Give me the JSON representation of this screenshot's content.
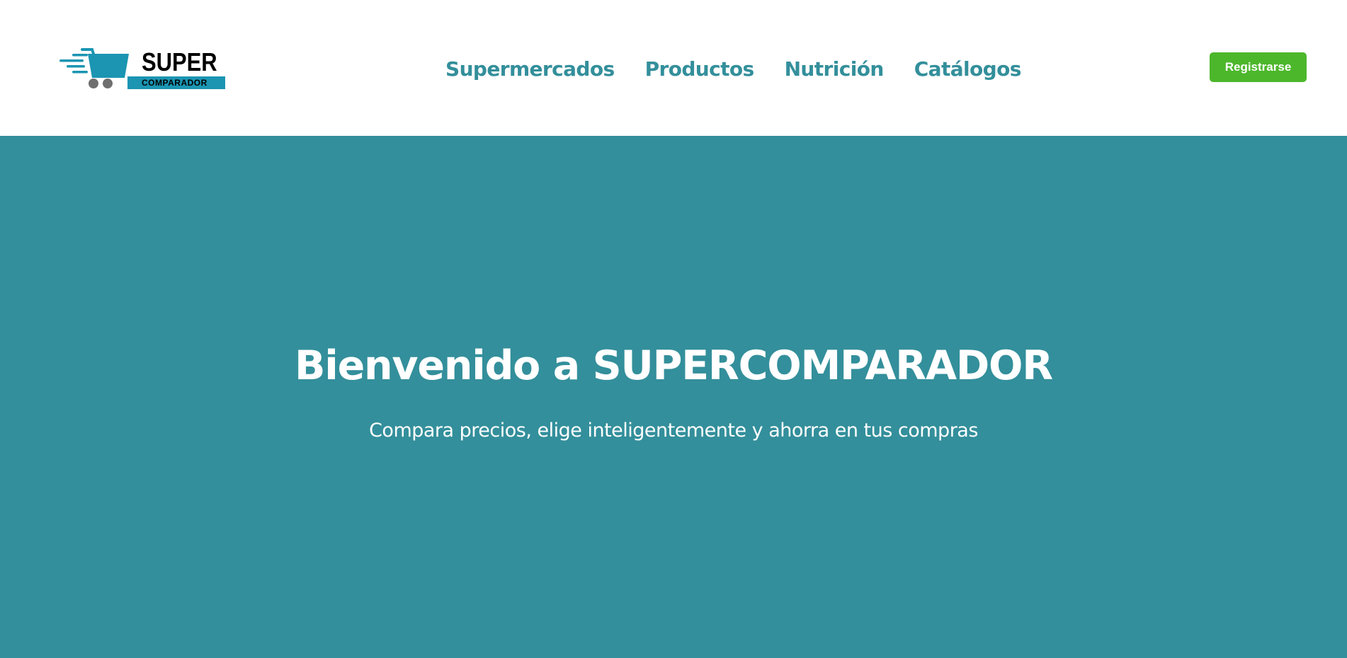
{
  "header": {
    "logo": {
      "title": "SUPER",
      "subtitle": "COMPARADOR",
      "icon": "shopping-cart-icon"
    },
    "nav": [
      {
        "label": "Supermercados"
      },
      {
        "label": "Productos"
      },
      {
        "label": "Nutrición"
      },
      {
        "label": "Catálogos"
      }
    ],
    "register_label": "Registrarse"
  },
  "hero": {
    "title": "Bienvenido a SUPERCOMPARADOR",
    "subtitle": "Compara precios, elige inteligentemente y ahorra en tus compras"
  },
  "colors": {
    "brand": "#338f9b",
    "logo_accent": "#1b95b2",
    "button": "#4db72c",
    "text_light": "#ffffff"
  }
}
